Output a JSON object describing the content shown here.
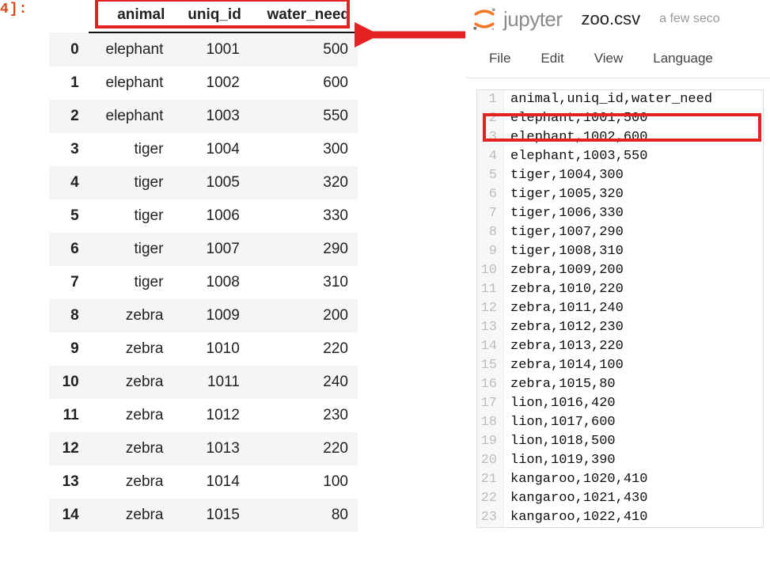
{
  "cell_label": "4]:",
  "dataframe": {
    "columns": [
      "animal",
      "uniq_id",
      "water_need"
    ],
    "index": [
      "0",
      "1",
      "2",
      "3",
      "4",
      "5",
      "6",
      "7",
      "8",
      "9",
      "10",
      "11",
      "12",
      "13",
      "14"
    ],
    "rows": [
      [
        "elephant",
        "1001",
        "500"
      ],
      [
        "elephant",
        "1002",
        "600"
      ],
      [
        "elephant",
        "1003",
        "550"
      ],
      [
        "tiger",
        "1004",
        "300"
      ],
      [
        "tiger",
        "1005",
        "320"
      ],
      [
        "tiger",
        "1006",
        "330"
      ],
      [
        "tiger",
        "1007",
        "290"
      ],
      [
        "tiger",
        "1008",
        "310"
      ],
      [
        "zebra",
        "1009",
        "200"
      ],
      [
        "zebra",
        "1010",
        "220"
      ],
      [
        "zebra",
        "1011",
        "240"
      ],
      [
        "zebra",
        "1012",
        "230"
      ],
      [
        "zebra",
        "1013",
        "220"
      ],
      [
        "zebra",
        "1014",
        "100"
      ],
      [
        "zebra",
        "1015",
        "80"
      ]
    ]
  },
  "jupyter": {
    "brand": "jupyter",
    "filename": "zoo.csv",
    "timestamp": "a few seco",
    "menu": [
      "File",
      "Edit",
      "View",
      "Language"
    ],
    "lines": [
      "animal,uniq_id,water_need",
      "elephant,1001,500",
      "elephant,1002,600",
      "elephant,1003,550",
      "tiger,1004,300",
      "tiger,1005,320",
      "tiger,1006,330",
      "tiger,1007,290",
      "tiger,1008,310",
      "zebra,1009,200",
      "zebra,1010,220",
      "zebra,1011,240",
      "zebra,1012,230",
      "zebra,1013,220",
      "zebra,1014,100",
      "zebra,1015,80",
      "lion,1016,420",
      "lion,1017,600",
      "lion,1018,500",
      "lion,1019,390",
      "kangaroo,1020,410",
      "kangaroo,1021,430",
      "kangaroo,1022,410"
    ]
  },
  "chart_data": {
    "type": "table",
    "columns": [
      "animal",
      "uniq_id",
      "water_need"
    ],
    "rows": [
      [
        "elephant",
        1001,
        500
      ],
      [
        "elephant",
        1002,
        600
      ],
      [
        "elephant",
        1003,
        550
      ],
      [
        "tiger",
        1004,
        300
      ],
      [
        "tiger",
        1005,
        320
      ],
      [
        "tiger",
        1006,
        330
      ],
      [
        "tiger",
        1007,
        290
      ],
      [
        "tiger",
        1008,
        310
      ],
      [
        "zebra",
        1009,
        200
      ],
      [
        "zebra",
        1010,
        220
      ],
      [
        "zebra",
        1011,
        240
      ],
      [
        "zebra",
        1012,
        230
      ],
      [
        "zebra",
        1013,
        220
      ],
      [
        "zebra",
        1014,
        100
      ],
      [
        "zebra",
        1015,
        80
      ],
      [
        "lion",
        1016,
        420
      ],
      [
        "lion",
        1017,
        600
      ],
      [
        "lion",
        1018,
        500
      ],
      [
        "lion",
        1019,
        390
      ],
      [
        "kangaroo",
        1020,
        410
      ],
      [
        "kangaroo",
        1021,
        430
      ],
      [
        "kangaroo",
        1022,
        410
      ]
    ]
  }
}
